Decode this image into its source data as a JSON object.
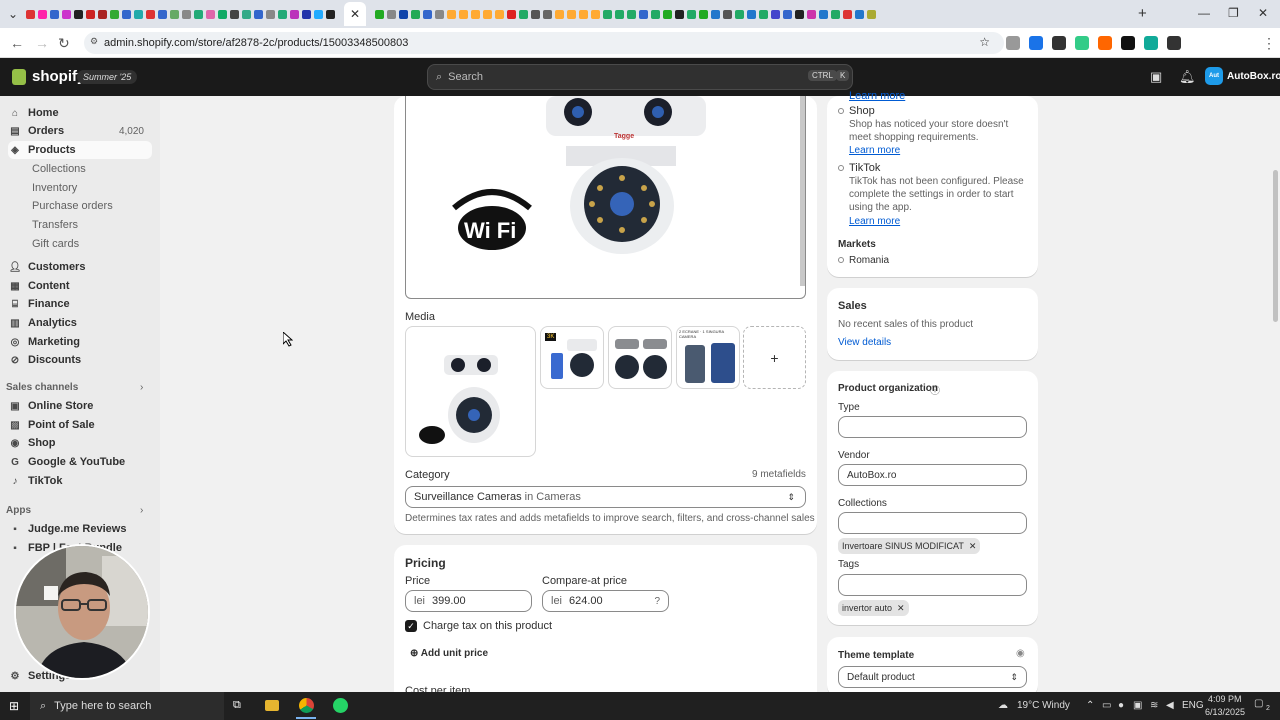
{
  "browser": {
    "url": "admin.shopify.com/store/af2878-2c/products/15003348500803",
    "tab_colors": [
      "#d33",
      "#f2a",
      "#36c",
      "#c3c",
      "#222",
      "#c22",
      "#a22",
      "#3a3",
      "#36c",
      "#2aa",
      "#d33",
      "#36c",
      "#6a6",
      "#888",
      "#2a7",
      "#d6a",
      "#1a6",
      "#444",
      "#3a8",
      "#36c",
      "#888",
      "#2a7",
      "#b3b",
      "#23a",
      "#2af",
      "#222"
    ],
    "tab_colors_right": [
      "#2a2",
      "#888",
      "#14a",
      "#2a5",
      "#36c",
      "#888",
      "#fa3",
      "#fa3",
      "#fa3",
      "#fa3",
      "#fa3",
      "#d22",
      "#2a6",
      "#555",
      "#666",
      "#fa3",
      "#fa3",
      "#fa3",
      "#fa3",
      "#2a6",
      "#2a6",
      "#2a6",
      "#36c",
      "#2a6",
      "#2a2",
      "#222",
      "#2a6",
      "#2a2",
      "#27c",
      "#555",
      "#2a6",
      "#27c",
      "#2a6",
      "#44c",
      "#36c",
      "#222",
      "#c3a",
      "#27c",
      "#2a6",
      "#d33",
      "#27c",
      "#aa3"
    ],
    "ext_colors": [
      "#999",
      "#1a73e8",
      "#333",
      "#3c8",
      "#f60",
      "#111",
      "#1a9",
      "#333"
    ]
  },
  "shopify": {
    "brand": "shopify",
    "edition": "Summer '25",
    "search_placeholder": "Search",
    "kbd_ctrl": "CTRL",
    "kbd_k": "K",
    "store_name": "AutoBox.ro",
    "store_initials": "Aut"
  },
  "sidebar": {
    "home": "Home",
    "orders": "Orders",
    "orders_count": "4,020",
    "products": "Products",
    "collections": "Collections",
    "inventory": "Inventory",
    "purchase_orders": "Purchase orders",
    "transfers": "Transfers",
    "gift_cards": "Gift cards",
    "customers": "Customers",
    "content": "Content",
    "finance": "Finance",
    "analytics": "Analytics",
    "marketing": "Marketing",
    "discounts": "Discounts",
    "sales_channels": "Sales channels",
    "online_store": "Online Store",
    "point_of_sale": "Point of Sale",
    "shop": "Shop",
    "google_youtube": "Google & YouTube",
    "tiktok": "TikTok",
    "apps": "Apps",
    "judgeme": "Judge.me Reviews",
    "fbp": "FBP | Fast Bundle",
    "settings": "Settings"
  },
  "main": {
    "wifi_label": "Wi Fi",
    "brand_mark": "Tagge",
    "media_label": "Media",
    "thumb_badge": "3K",
    "thumb3_caption": "2 ECRANE · 1 SINGURA CAMERA",
    "add_media": "+",
    "category_label": "Category",
    "metafields": "9 metafields",
    "category_value": "Surveillance Cameras",
    "category_suffix": "in Cameras",
    "category_help": "Determines tax rates and adds metafields to improve search, filters, and cross-channel sales",
    "pricing_title": "Pricing",
    "price_label": "Price",
    "currency": "lei",
    "price_value": "399.00",
    "compare_label": "Compare-at price",
    "compare_value": "624.00",
    "charge_tax": "Charge tax on this product",
    "add_unit_price": "Add unit price",
    "cost_per_item": "Cost per item"
  },
  "right": {
    "learn_more": "Learn more",
    "shop_title": "Shop",
    "shop_text": "Shop has noticed your store doesn't meet shopping requirements.",
    "tiktok_title": "TikTok",
    "tiktok_text": "TikTok has not been configured. Please complete the settings in order to start using the app.",
    "markets_title": "Markets",
    "market_romania": "Romania",
    "sales_title": "Sales",
    "sales_text": "No recent sales of this product",
    "view_details": "View details",
    "org_title": "Product organization",
    "type_label": "Type",
    "vendor_label": "Vendor",
    "vendor_value": "AutoBox.ro",
    "collections_label": "Collections",
    "collection_chip": "Invertoare SINUS MODIFICAT",
    "tags_label": "Tags",
    "tag_chip": "invertor auto",
    "theme_title": "Theme template",
    "theme_value": "Default product"
  },
  "taskbar": {
    "search_placeholder": "Type here to search",
    "weather": "19°C  Windy",
    "lang": "ENG",
    "time": "4:09 PM",
    "date": "6/13/2025",
    "notif_count": "2"
  }
}
